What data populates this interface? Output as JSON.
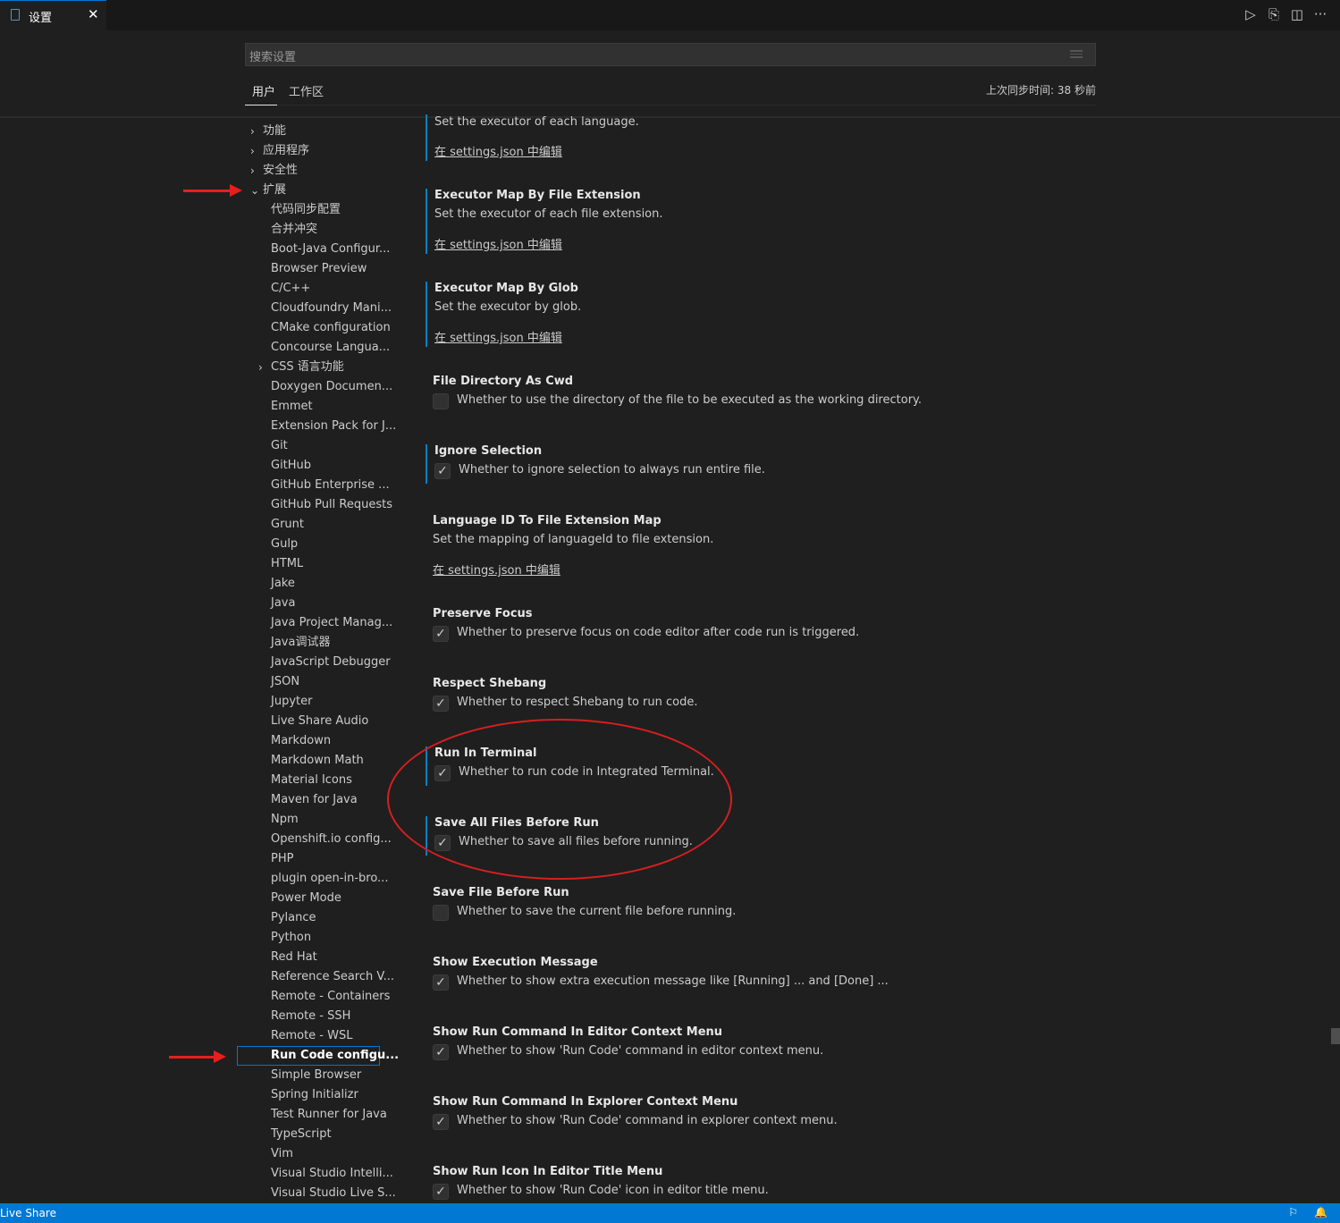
{
  "tab": {
    "title": "设置",
    "close": "✕"
  },
  "editor_actions": {
    "run": "▷",
    "open_json": "⎘",
    "split": "◫",
    "more": "···"
  },
  "search": {
    "placeholder": "搜索设置"
  },
  "scope": {
    "user": "用户",
    "workspace": "工作区",
    "sync": "上次同步时间: 38 秒前"
  },
  "toc": {
    "top": [
      {
        "label": "功能",
        "chevron": "›"
      },
      {
        "label": "应用程序",
        "chevron": "›"
      },
      {
        "label": "安全性",
        "chevron": "›"
      },
      {
        "label": "扩展",
        "chevron": "⌄"
      }
    ],
    "extensions": [
      "代码同步配置",
      "合并冲突",
      "Boot-Java Configur...",
      "Browser Preview",
      "C/C++",
      "Cloudfoundry Mani...",
      "CMake configuration",
      "Concourse Langua...",
      "CSS 语言功能",
      "Doxygen Documen...",
      "Emmet",
      "Extension Pack for J...",
      "Git",
      "GitHub",
      "GitHub Enterprise ...",
      "GitHub Pull Requests",
      "Grunt",
      "Gulp",
      "HTML",
      "Jake",
      "Java",
      "Java Project Manag...",
      "Java调试器",
      "JavaScript Debugger",
      "JSON",
      "Jupyter",
      "Live Share Audio",
      "Markdown",
      "Markdown Math",
      "Material Icons",
      "Maven for Java",
      "Npm",
      "Openshift.io config...",
      "PHP",
      "plugin open-in-bro...",
      "Power Mode",
      "Pylance",
      "Python",
      "Red Hat",
      "Reference Search V...",
      "Remote - Containers",
      "Remote - SSH",
      "Remote - WSL",
      "Run Code configu...",
      "Simple Browser",
      "Spring Initializr",
      "Test Runner for Java",
      "TypeScript",
      "Vim",
      "Visual Studio Intelli...",
      "Visual Studio Live S..."
    ],
    "css_chevron": "›",
    "selected": "Run Code configu..."
  },
  "settings": {
    "executor_map": {
      "desc": "Set the executor of each language.",
      "link": "在 settings.json 中编辑"
    },
    "by_ext": {
      "title": "Executor Map By File Extension",
      "desc": "Set the executor of each file extension.",
      "link": "在 settings.json 中编辑"
    },
    "by_glob": {
      "title": "Executor Map By Glob",
      "desc": "Set the executor by glob.",
      "link": "在 settings.json 中编辑"
    },
    "file_dir_cwd": {
      "title": "File Directory As Cwd",
      "desc": "Whether to use the directory of the file to be executed as the working directory.",
      "checked": false
    },
    "ignore_selection": {
      "title": "Ignore Selection",
      "desc": "Whether to ignore selection to always run entire file.",
      "checked": true
    },
    "lang_map": {
      "title": "Language ID To File Extension Map",
      "desc": "Set the mapping of languageId to file extension.",
      "link": "在 settings.json 中编辑"
    },
    "preserve_focus": {
      "title": "Preserve Focus",
      "desc": "Whether to preserve focus on code editor after code run is triggered.",
      "checked": true
    },
    "respect_shebang": {
      "title": "Respect Shebang",
      "desc": "Whether to respect Shebang to run code.",
      "checked": true
    },
    "run_in_terminal": {
      "title": "Run In Terminal",
      "desc": "Whether to run code in Integrated Terminal.",
      "checked": true
    },
    "save_all": {
      "title": "Save All Files Before Run",
      "desc": "Whether to save all files before running.",
      "checked": true
    },
    "save_file": {
      "title": "Save File Before Run",
      "desc": "Whether to save the current file before running.",
      "checked": false
    },
    "show_exec_msg": {
      "title": "Show Execution Message",
      "desc": "Whether to show extra execution message like [Running] ... and [Done] ...",
      "checked": true
    },
    "show_editor_ctx": {
      "title": "Show Run Command In Editor Context Menu",
      "desc": "Whether to show 'Run Code' command in editor context menu.",
      "checked": true
    },
    "show_explorer_ctx": {
      "title": "Show Run Command In Explorer Context Menu",
      "desc": "Whether to show 'Run Code' command in explorer context menu.",
      "checked": true
    },
    "show_title_icon": {
      "title": "Show Run Icon In Editor Title Menu",
      "desc": "Whether to show 'Run Code' icon in editor title menu.",
      "checked": true
    }
  },
  "checkmark": "✓",
  "statusbar": {
    "live_share": "Live Share",
    "feedback": "⚐",
    "bell": "🔔"
  },
  "colors": {
    "accent": "#0078d4",
    "annotation": "#e81e1e"
  }
}
